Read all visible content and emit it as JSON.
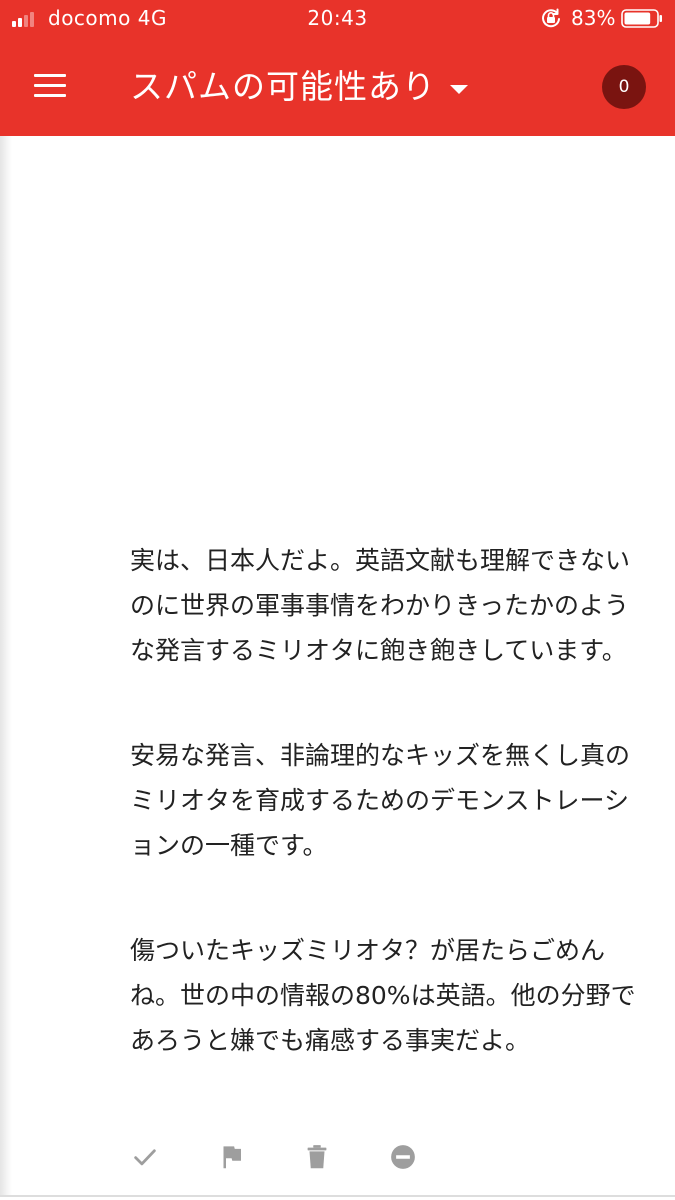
{
  "status_bar": {
    "carrier": "docomo 4G",
    "time": "20:43",
    "battery_percent": "83%",
    "battery_level": 0.83,
    "signal_bars_active": 2,
    "signal_bars_total": 4
  },
  "app_bar": {
    "title": "スパムの可能性あり",
    "count": "0"
  },
  "message": {
    "paragraphs": [
      "実は、日本人だよ。英語文献も理解できないのに世界の軍事事情をわかりきったかのような発言するミリオタに飽き飽きしています。",
      "安易な発言、非論理的なキッズを無くし真のミリオタを育成するためのデモンストレーションの一種です。",
      "傷ついたキッズミリオタ？が居たらごめんね。世の中の情報の80%は英語。他の分野であろうと嫌でも痛感する事実だよ。"
    ]
  },
  "actions": [
    {
      "icon": "check-icon"
    },
    {
      "icon": "flag-icon"
    },
    {
      "icon": "trash-icon"
    },
    {
      "icon": "block-icon"
    }
  ],
  "colors": {
    "brand": "#e8332a",
    "badge": "#7a1410",
    "text": "#222222",
    "action_icon": "#9e9e9e"
  }
}
